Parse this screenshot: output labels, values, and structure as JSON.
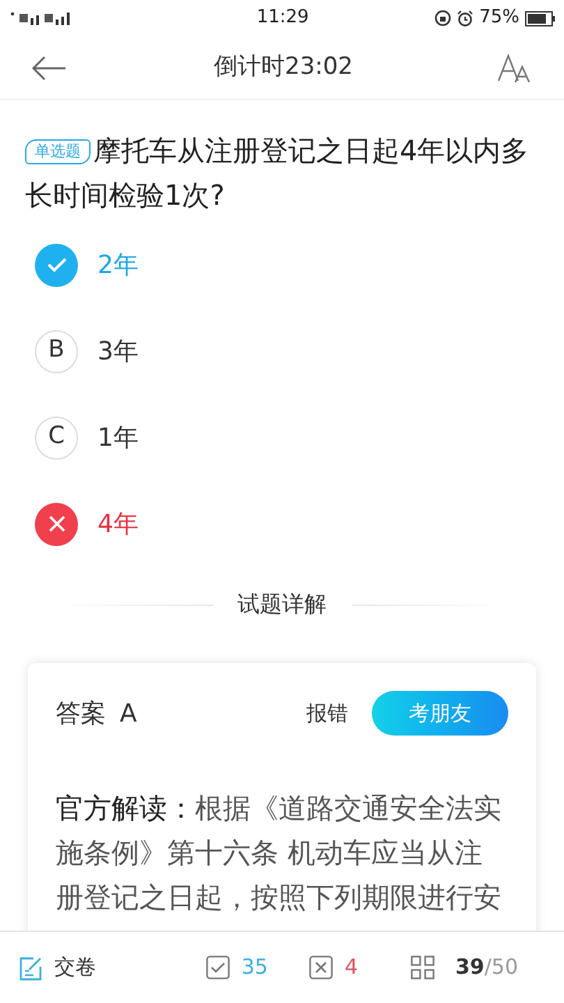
{
  "status_bar": {
    "time": "11:29",
    "battery": "75%"
  },
  "header": {
    "title": "倒计时23:02"
  },
  "question": {
    "tag": "单选题",
    "text": "摩托车从注册登记之日起4年以内多长时间检验1次?"
  },
  "options": [
    {
      "text": "2年",
      "kind": "correct"
    },
    {
      "letter": "B",
      "text": "3年",
      "kind": "letter"
    },
    {
      "letter": "C",
      "text": "1年",
      "kind": "letter"
    },
    {
      "text": "4年",
      "kind": "wrong"
    }
  ],
  "section_title": "试题详解",
  "answer_card": {
    "answer_label": "答案",
    "answer": "A",
    "report": "报错",
    "quiz_button": "考朋友",
    "explanation": "**官方解读：**根据《道路交通安全法实施条例》第十六条 机动车应当从注册登记之日起，按照下列期限进行安"
  },
  "bottom_bar": {
    "submit": "交卷",
    "correct_count": "35",
    "wrong_count": "4",
    "progress_current": "39",
    "progress_total": "/50"
  }
}
